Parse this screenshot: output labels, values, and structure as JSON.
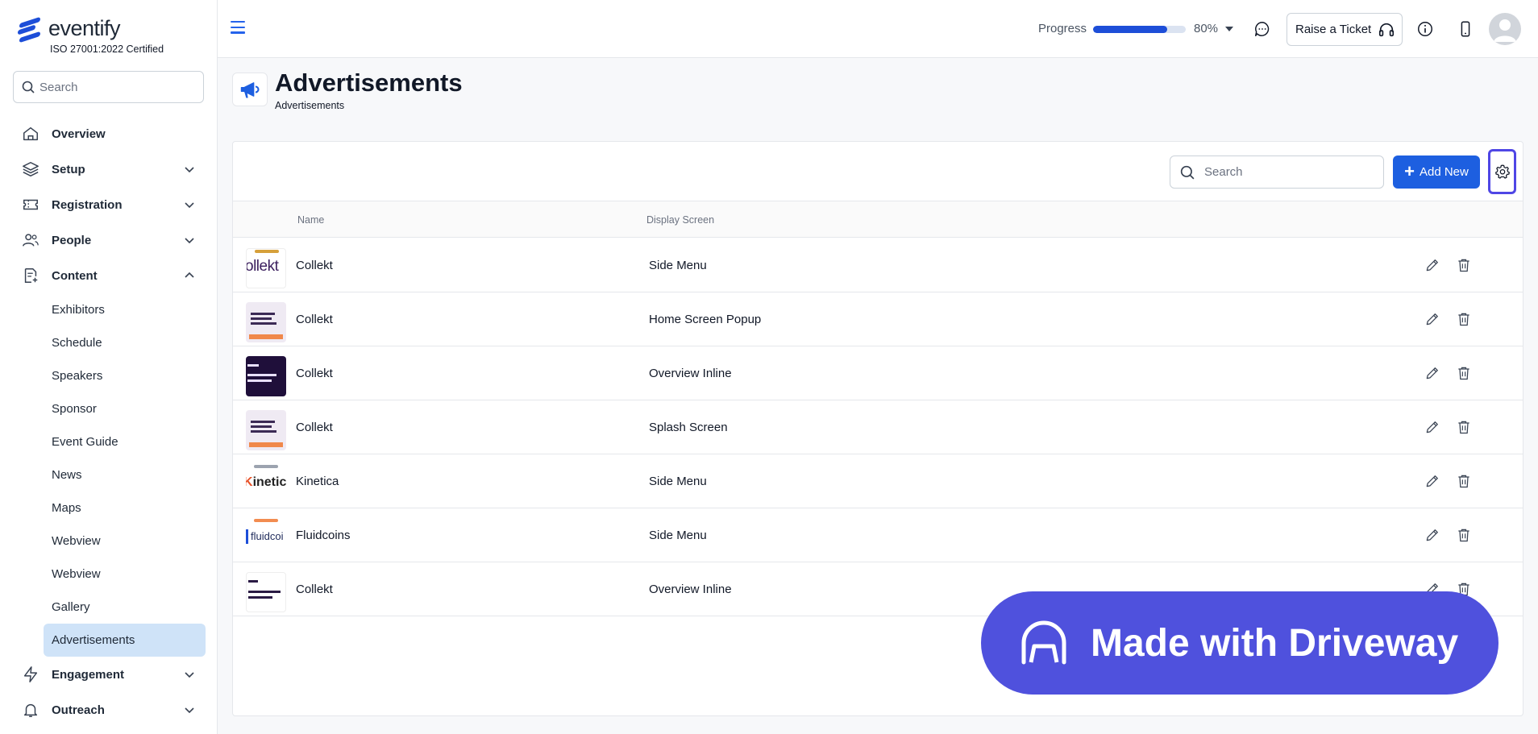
{
  "brand": {
    "name": "eventify",
    "certification": "ISO 27001:2022 Certified"
  },
  "sidebar": {
    "search_placeholder": "Search",
    "items": [
      {
        "label": "Overview",
        "icon": "home-icon"
      },
      {
        "label": "Setup",
        "icon": "layers-icon"
      },
      {
        "label": "Registration",
        "icon": "ticket-icon"
      },
      {
        "label": "People",
        "icon": "people-icon"
      },
      {
        "label": "Content",
        "icon": "document-plus-icon"
      },
      {
        "label": "Engagement",
        "icon": "lightning-icon"
      },
      {
        "label": "Outreach",
        "icon": "bell-icon"
      }
    ],
    "content_subitems": [
      "Exhibitors",
      "Schedule",
      "Speakers",
      "Sponsor",
      "Event Guide",
      "News",
      "Maps",
      "Webview",
      "Webview",
      "Gallery",
      "Advertisements"
    ],
    "active_subitem": "Advertisements"
  },
  "header": {
    "progress_label": "Progress",
    "progress_value": "80%",
    "progress_fraction": 0.8,
    "raise_ticket_label": "Raise a Ticket"
  },
  "page": {
    "title": "Advertisements",
    "breadcrumb": "Advertisements"
  },
  "table": {
    "search_placeholder": "Search",
    "add_new_label": "Add New",
    "columns": [
      "Name",
      "Display Screen"
    ],
    "rows": [
      {
        "name": "Collekt",
        "display_screen": "Side Menu",
        "thumb": "collekt-logo"
      },
      {
        "name": "Collekt",
        "display_screen": "Home Screen Popup",
        "thumb": "collekt-card"
      },
      {
        "name": "Collekt",
        "display_screen": "Overview Inline",
        "thumb": "collekt-dark"
      },
      {
        "name": "Collekt",
        "display_screen": "Splash Screen",
        "thumb": "collekt-card"
      },
      {
        "name": "Kinetica",
        "display_screen": "Side Menu",
        "thumb": "kinetica-logo"
      },
      {
        "name": "Fluidcoins",
        "display_screen": "Side Menu",
        "thumb": "fluidcoins-logo"
      },
      {
        "name": "Collekt",
        "display_screen": "Overview Inline",
        "thumb": "collekt-white"
      }
    ]
  },
  "badge": {
    "text": "Made with Driveway"
  },
  "colors": {
    "primary": "#1d5fe0",
    "accent": "#4f46e5",
    "badge": "#4f51dd",
    "active_bg": "#cfe3f8"
  }
}
